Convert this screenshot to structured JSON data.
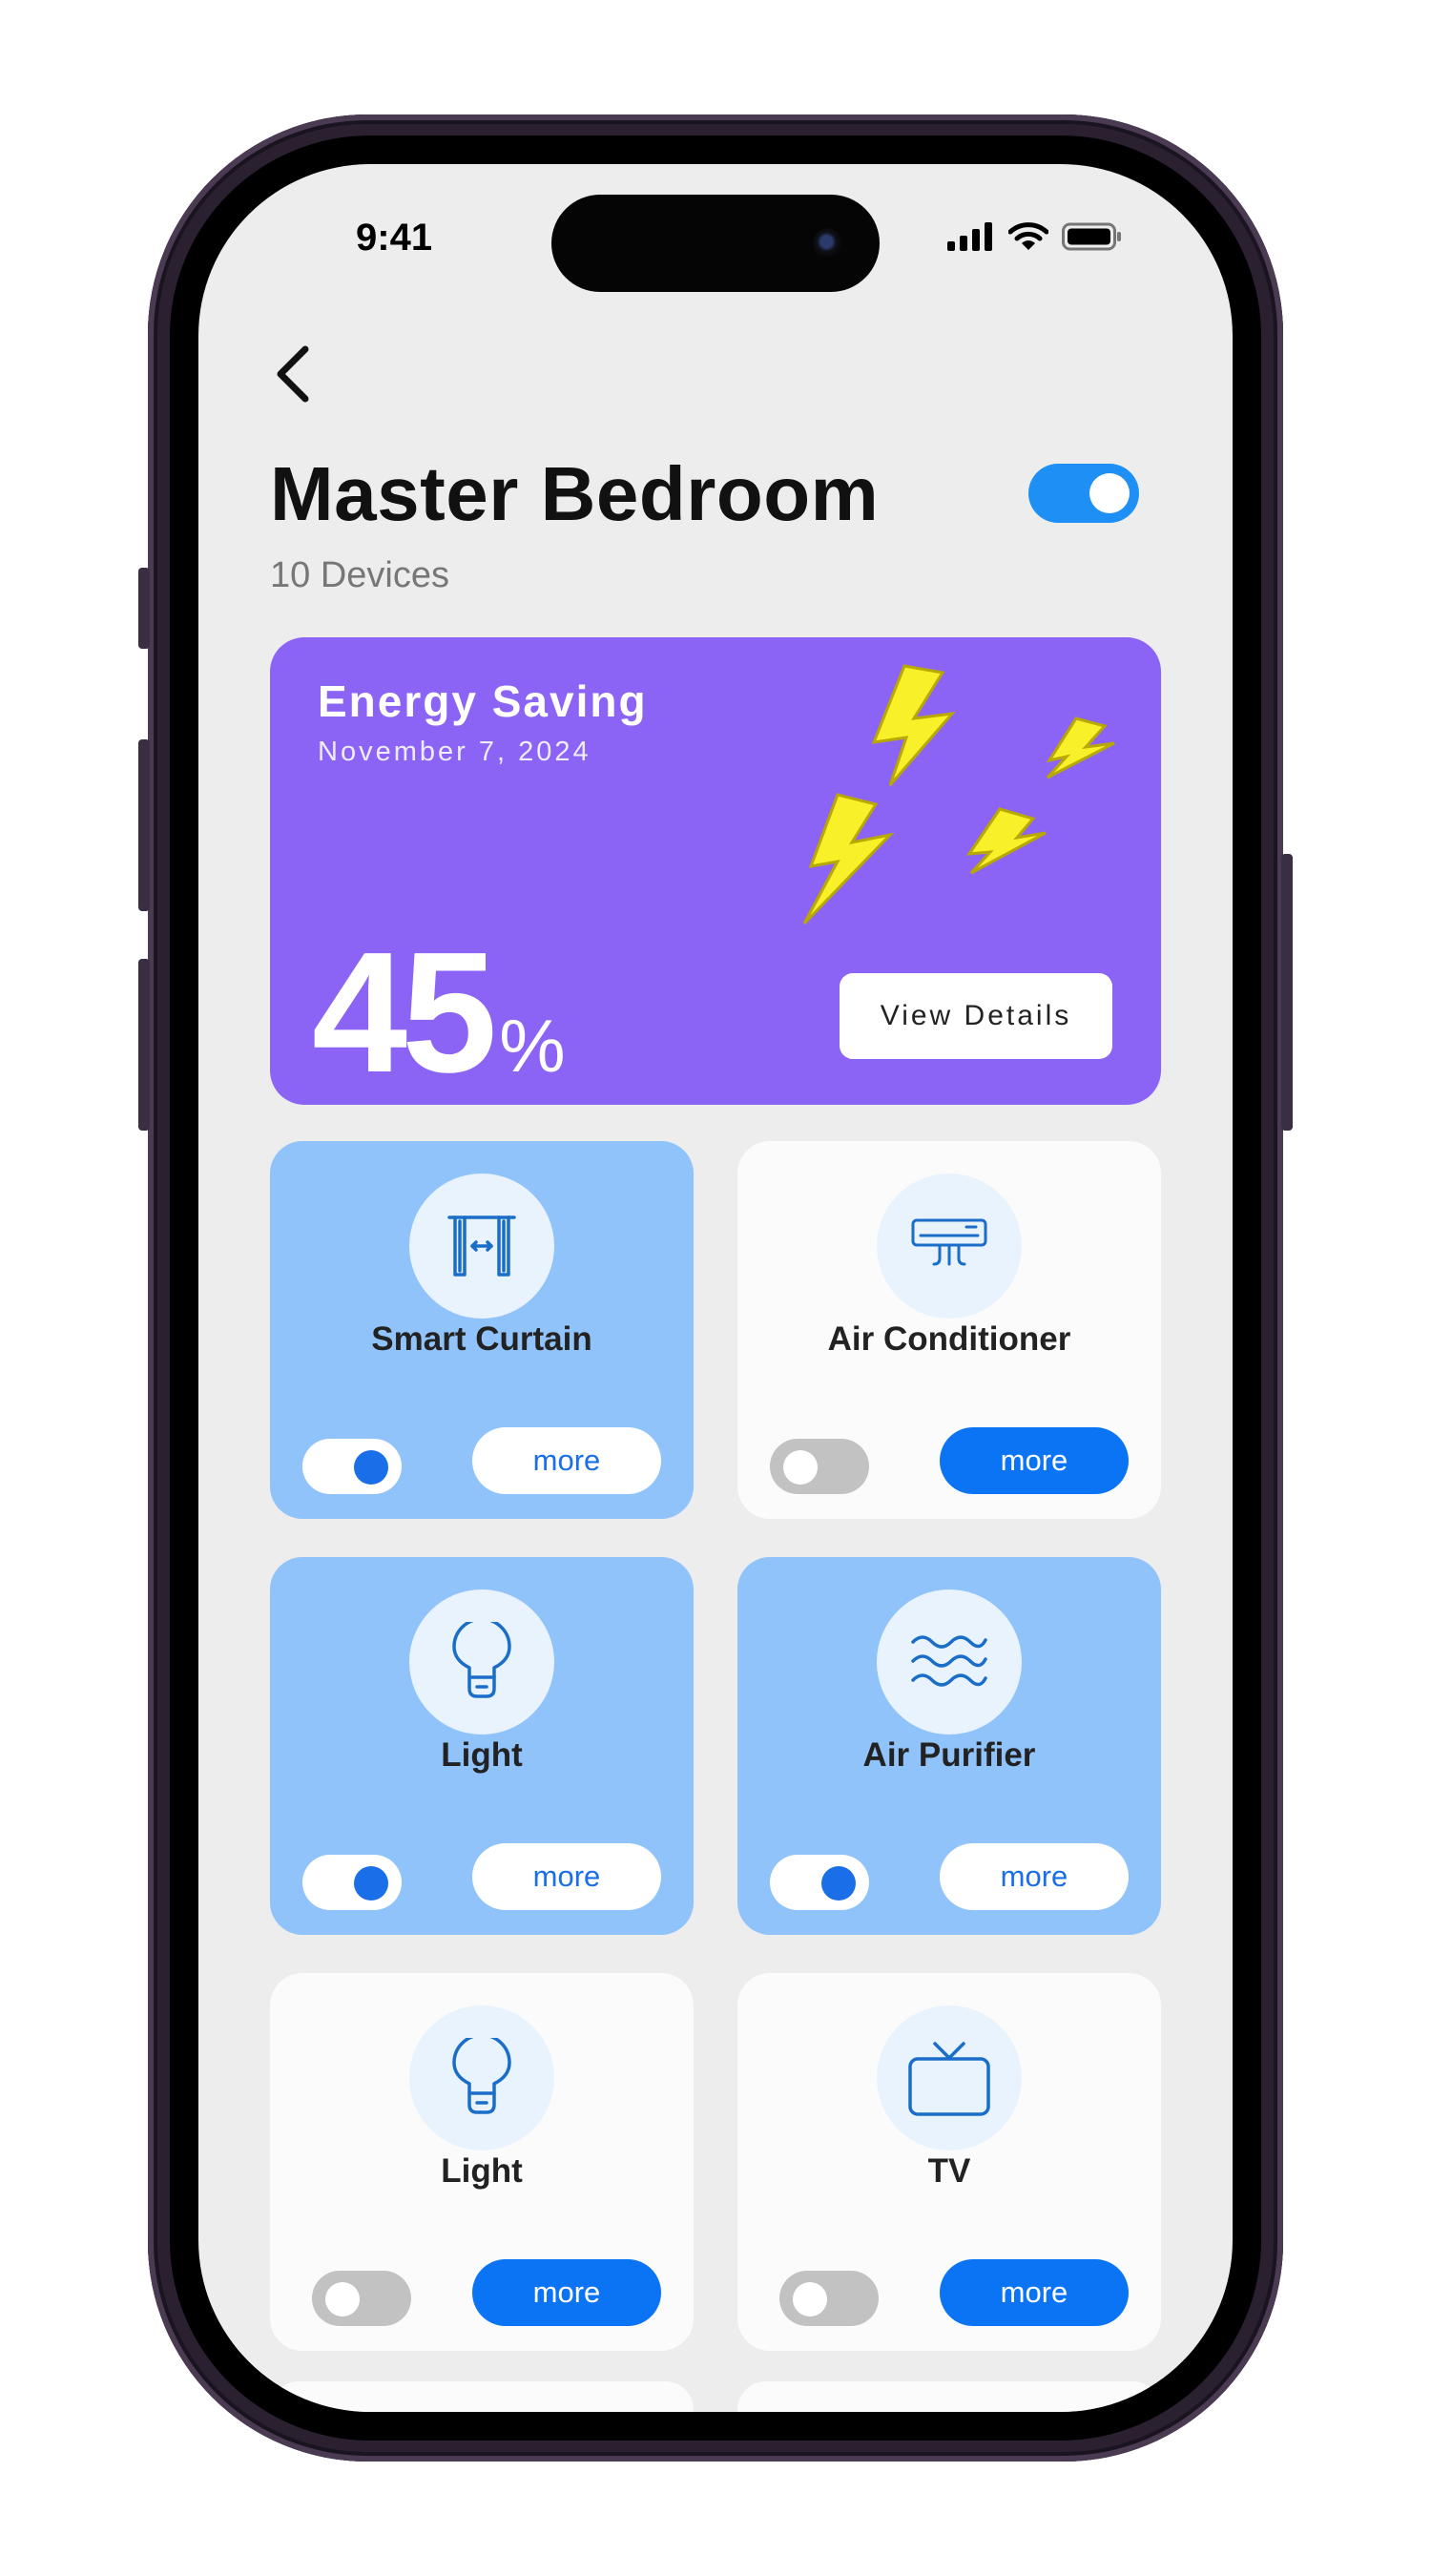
{
  "status_bar": {
    "time": "9:41"
  },
  "header": {
    "title": "Master Bedroom",
    "subtitle": "10 Devices",
    "room_power": true
  },
  "energy_card": {
    "title": "Energy Saving",
    "date": "November 7, 2024",
    "percent": "45",
    "percent_symbol": "%",
    "button_label": "View Details",
    "background": "#8b64f5"
  },
  "devices": [
    {
      "name": "Smart Curtain",
      "icon": "curtain-icon",
      "on": true,
      "more_label": "more"
    },
    {
      "name": "Air Conditioner",
      "icon": "air-conditioner-icon",
      "on": false,
      "more_label": "more"
    },
    {
      "name": "Light",
      "icon": "lightbulb-icon",
      "on": true,
      "more_label": "more"
    },
    {
      "name": "Air Purifier",
      "icon": "air-purifier-icon",
      "on": true,
      "more_label": "more"
    },
    {
      "name": "Light",
      "icon": "lightbulb-icon",
      "on": false,
      "more_label": "more"
    },
    {
      "name": "TV",
      "icon": "tv-icon",
      "on": false,
      "more_label": "more"
    }
  ],
  "colors": {
    "accent": "#1e8ff5",
    "card_on": "#91c3fb",
    "card_off": "#fbfbfb",
    "icon": "#1a6ec8"
  }
}
